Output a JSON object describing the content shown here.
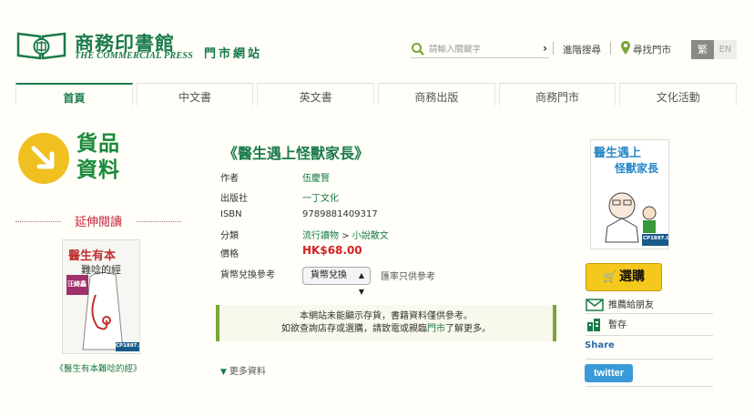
{
  "header": {
    "logo_cn": "商務印書館",
    "logo_en": "THE COMMERCIAL PRESS",
    "site_name": "門市網站",
    "search_placeholder": "請輸入關鍵字",
    "search_go": "›",
    "adv_search": "進階搜尋",
    "store_finder": "尋找門市",
    "lang_trad": "繁",
    "lang_en": "EN"
  },
  "nav": {
    "tabs": [
      {
        "label": "首頁",
        "active": true
      },
      {
        "label": "中文書",
        "active": false
      },
      {
        "label": "英文書",
        "active": false
      },
      {
        "label": "商務出版",
        "active": false
      },
      {
        "label": "商務門市",
        "active": false
      },
      {
        "label": "文化活動",
        "active": false
      }
    ]
  },
  "left": {
    "section_title_line1": "貨品",
    "section_title_line2": "資料",
    "extended_reading": "延伸閱讀",
    "related_book": {
      "title": "《醫生有本難唸的經》",
      "cover_line1": "醫生有本",
      "cover_line2": "難唸的經",
      "cover_badge": "汪綺鑫",
      "cover_brand": "CP1897.COM"
    }
  },
  "product": {
    "title": "《醫生遇上怪獸家長》",
    "fields": {
      "author_label": "作者",
      "author": "伍慶賢",
      "publisher_label": "出版社",
      "publisher": "一丁文化",
      "isbn_label": "ISBN",
      "isbn": "9789881409317",
      "category_label": "分類",
      "category_1": "流行讀物",
      "category_sep": ">",
      "category_2": "小說散文",
      "price_label": "價格",
      "price": "HK$68.00",
      "currency_label": "貨幣兌換參考",
      "currency_select": "貨幣兌換",
      "currency_note": "匯率只供參考"
    },
    "notice_line1": "本網站未能顯示存貨，書籍資料僅供參考。",
    "notice_line2_pre": "如欲查詢店存或選購，請致電或親臨",
    "notice_link": "門市",
    "notice_line2_post": "了解更多。",
    "more_info": "更多資料"
  },
  "right": {
    "cover_line1": "醫生遇上",
    "cover_line2": "怪獸家長",
    "cover_brand": "CP1897.COM",
    "buy_label": "選購",
    "recommend_label": "推薦給朋友",
    "save_label": "暫存",
    "share_label": "Share",
    "twitter_label": "twitter"
  },
  "colors": {
    "brand_green": "#1a7a4a",
    "price_red": "#d62020",
    "buy_yellow": "#f4c81c",
    "notice_border": "#7aa63a"
  }
}
